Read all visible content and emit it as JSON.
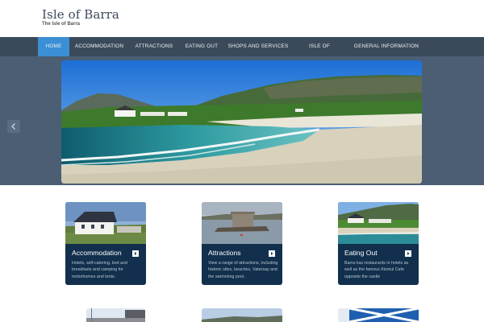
{
  "site": {
    "title": "Isle of Barra",
    "tagline": "The Isle of Barra"
  },
  "nav": {
    "items": [
      {
        "label": "HOME",
        "active": true
      },
      {
        "label": "ACCOMMODATION"
      },
      {
        "label": "ATTRACTIONS"
      },
      {
        "label": "EATING OUT"
      },
      {
        "label": "SHOPS AND SERVICES"
      },
      {
        "label": "ISLE OF VATERSAY"
      },
      {
        "label": "GENERAL INFORMATION"
      }
    ]
  },
  "slider": {
    "prev_icon": "chevron-left-icon"
  },
  "cards": [
    {
      "title": "Accommodation",
      "description": "Hotels, self-catering, bed and breakfasts and camping for motorhomes and tents.",
      "link_icon": "arrow-right-icon"
    },
    {
      "title": "Attractions",
      "description": "View a range of attractions, including historic sites, beaches, Vatersay and the swimming pool..",
      "link_icon": "arrow-right-icon"
    },
    {
      "title": "Eating Out",
      "description": "Barra has restaurants in hotels as well as the famous Kismul Cafe opposite the castle",
      "link_icon": "arrow-right-icon"
    }
  ],
  "colors": {
    "nav_bg": "#3b4a5a",
    "nav_active": "#3b8fd4",
    "hero_band": "#4b5e74",
    "card_bg": "#12304d"
  }
}
